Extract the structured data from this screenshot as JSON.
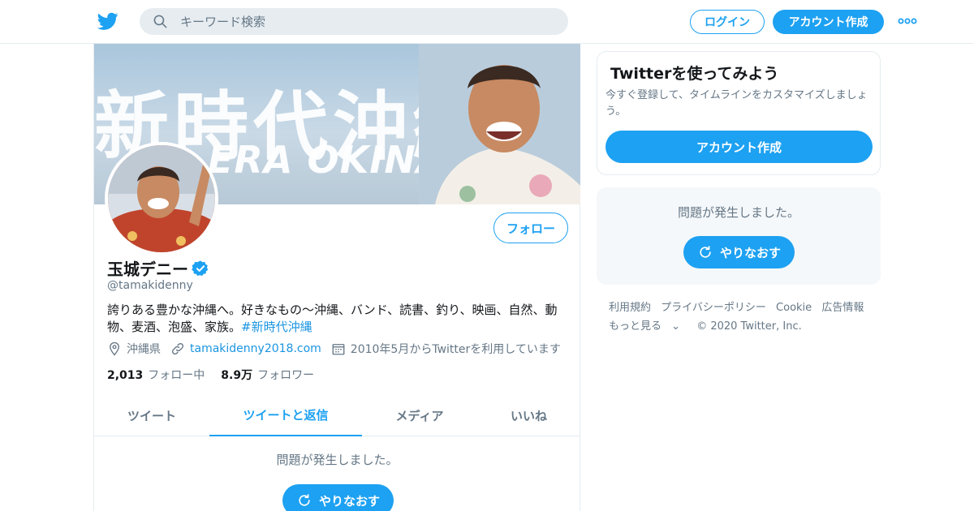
{
  "header": {
    "search_placeholder": "キーワード検索",
    "login_label": "ログイン",
    "signup_label": "アカウント作成",
    "brand_color": "#1da1f2"
  },
  "banner": {
    "text_line1": "新時代沖縄",
    "text_line2": "ERA OKINAWA"
  },
  "profile": {
    "follow_label": "フォロー",
    "display_name": "玉城デニー",
    "handle": "@tamakidenny",
    "bio_text": "誇りある豊かな沖縄へ。好きなもの〜沖縄、バンド、読書、釣り、映画、自然、動物、麦酒、泡盛、家族。",
    "bio_hashtag": "#新時代沖縄",
    "location": "沖縄県",
    "website": "tamakidenny2018.com",
    "joined": "2010年5月からTwitterを利用しています",
    "following_count": "2,013",
    "following_label": "フォロー中",
    "followers_count": "8.9万",
    "followers_label": "フォロワー"
  },
  "tabs": [
    {
      "label": "ツイート",
      "active": false
    },
    {
      "label": "ツイートと返信",
      "active": true
    },
    {
      "label": "メディア",
      "active": false
    },
    {
      "label": "いいね",
      "active": false
    }
  ],
  "timeline": {
    "error_text": "問題が発生しました。",
    "retry_label": "やりなおす"
  },
  "sidebar": {
    "card_title": "Twitterを使ってみよう",
    "card_subtitle": "今すぐ登録して、タイムラインをカスタマイズしましょう。",
    "card_signup_label": "アカウント作成",
    "error_text": "問題が発生しました。",
    "retry_label": "やりなおす"
  },
  "footer": {
    "links": [
      "利用規約",
      "プライバシーポリシー",
      "Cookie",
      "広告情報"
    ],
    "more_label": "もっと見る",
    "copyright": "© 2020 Twitter, Inc."
  },
  "icons": {
    "logo": "twitter-bird-icon",
    "search": "search-icon",
    "more": "more-dots-icon",
    "verified": "verified-badge-icon",
    "location": "location-pin-icon",
    "link": "link-icon",
    "calendar": "calendar-icon",
    "retry": "refresh-icon"
  }
}
